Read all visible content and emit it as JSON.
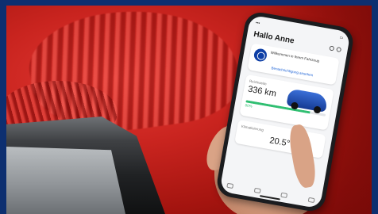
{
  "app": {
    "greeting": "Hallo Anne",
    "notification": {
      "text": "Willkommen in Ihrem Fahrzeug",
      "link": "Benachrichtigung ansehen"
    },
    "range": {
      "label": "Reichweite",
      "value": "336 km",
      "charge_label": "80%",
      "charge_fraction": 0.8
    },
    "climate": {
      "label": "Klimatisierung",
      "value": "20.5°"
    }
  },
  "colors": {
    "frame": "#0d2f70",
    "accent": "#1d63d6",
    "charge": "#2fbf71"
  }
}
